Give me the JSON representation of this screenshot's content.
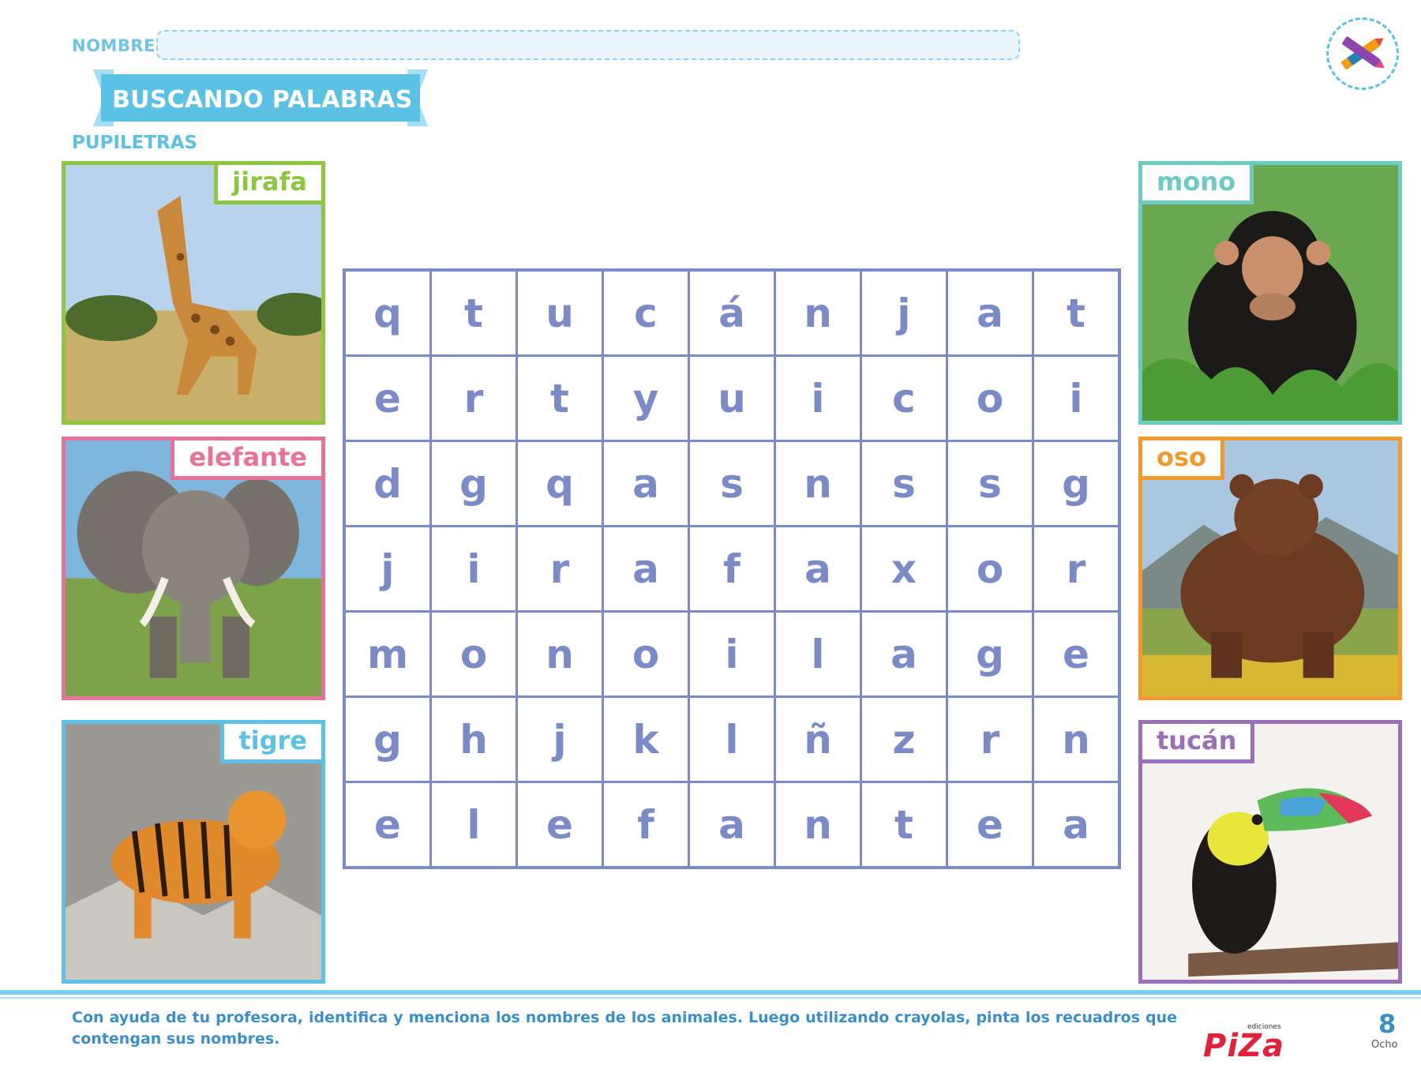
{
  "header": {
    "nombre_label": "NOMBRE:",
    "title": "BUSCANDO PALABRAS",
    "subtitle": "PUPILETRAS",
    "logo_icon": "crayon-icon"
  },
  "animals": [
    {
      "label": "jirafa",
      "color": "#8dc63f"
    },
    {
      "label": "elefante",
      "color": "#e8729a"
    },
    {
      "label": "tigre",
      "color": "#5bc2e6"
    },
    {
      "label": "mono",
      "color": "#6dcbc3"
    },
    {
      "label": "oso",
      "color": "#f29a2e"
    },
    {
      "label": "tucán",
      "color": "#9b6fb8"
    }
  ],
  "grid": [
    [
      "q",
      "t",
      "u",
      "c",
      "á",
      "n",
      "j",
      "a",
      "t"
    ],
    [
      "e",
      "r",
      "t",
      "y",
      "u",
      "i",
      "c",
      "o",
      "i"
    ],
    [
      "d",
      "g",
      "q",
      "a",
      "s",
      "n",
      "s",
      "s",
      "g"
    ],
    [
      "j",
      "i",
      "r",
      "a",
      "f",
      "a",
      "x",
      "o",
      "r"
    ],
    [
      "m",
      "o",
      "n",
      "o",
      "i",
      "l",
      "a",
      "g",
      "e"
    ],
    [
      "g",
      "h",
      "j",
      "k",
      "l",
      "ñ",
      "z",
      "r",
      "n"
    ],
    [
      "e",
      "l",
      "e",
      "f",
      "a",
      "n",
      "t",
      "e",
      "a"
    ]
  ],
  "footer": {
    "instructions": "Con ayuda de tu profesora, identifica y menciona los nombres de los animales. Luego utilizando crayolas, pinta los recuadros que contengan sus nombres.",
    "brand_sub": "ediciones",
    "brand": "PiZa",
    "page_number": "8",
    "page_word": "Ocho"
  }
}
